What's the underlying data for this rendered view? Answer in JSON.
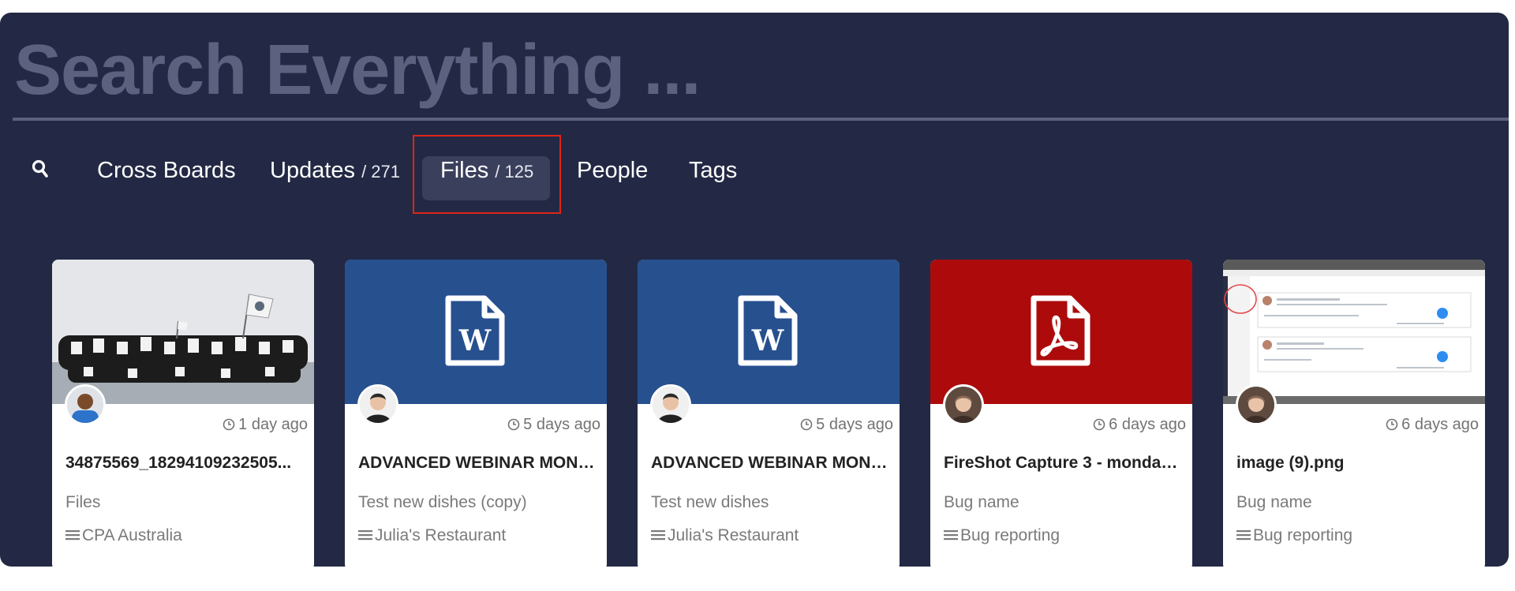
{
  "search": {
    "title": "Search Everything ..."
  },
  "tabs": [
    {
      "label": "Cross Boards",
      "count": ""
    },
    {
      "label": "Updates",
      "count": "/ 271"
    },
    {
      "label": "Files",
      "count": "/ 125",
      "active": true
    },
    {
      "label": "People",
      "count": ""
    },
    {
      "label": "Tags",
      "count": ""
    }
  ],
  "colors": {
    "panel": "#232944",
    "word": "#27508f",
    "pdf": "#ad0b0b",
    "highlight": "#e02418"
  },
  "cards": [
    {
      "thumb": "photo",
      "avatar": "user-avatar",
      "time": "1 day ago",
      "title": "34875569_18294109232505...",
      "item": "Files",
      "board": "CPA Australia"
    },
    {
      "thumb": "word-file-icon",
      "avatar": "user-avatar",
      "time": "5 days ago",
      "title": "ADVANCED WEBINAR MOND...",
      "item": "Test new dishes (copy)",
      "board": "Julia's Restaurant"
    },
    {
      "thumb": "word-file-icon",
      "avatar": "user-avatar",
      "time": "5 days ago",
      "title": "ADVANCED WEBINAR MOND...",
      "item": "Test new dishes",
      "board": "Julia's Restaurant"
    },
    {
      "thumb": "pdf-file-icon",
      "avatar": "user-avatar",
      "time": "6 days ago",
      "title": "FireShot Capture 3 - monday ...",
      "item": "Bug name",
      "board": "Bug reporting"
    },
    {
      "thumb": "screenshot",
      "avatar": "user-avatar",
      "time": "6 days ago",
      "title": "image (9).png",
      "item": "Bug name",
      "board": "Bug reporting"
    }
  ]
}
